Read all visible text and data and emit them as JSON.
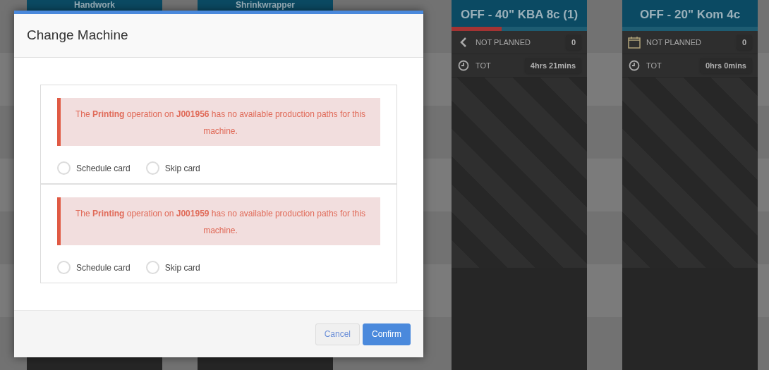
{
  "board": {
    "columns": [
      {
        "title": "Handwork"
      },
      {
        "title": "Shrinkwrapper"
      },
      {
        "title": "OFF - 40\" KBA 8c (1)",
        "progress": {
          "level": 0.37
        },
        "rows": [
          {
            "kind": "back",
            "label": "NOT PLANNED",
            "value": "0"
          },
          {
            "kind": "clock",
            "label": "TOT",
            "value": "4hrs 21mins"
          }
        ]
      },
      {
        "title": "OFF - 20\" Kom 4c",
        "rows": [
          {
            "kind": "calendar",
            "label": "NOT PLANNED",
            "value": "0"
          },
          {
            "kind": "clock",
            "label": "TOT",
            "value": "0hrs 0mins"
          }
        ]
      }
    ]
  },
  "dialog": {
    "title": "Change Machine",
    "cards": [
      {
        "message": "The **Printing** operation on **J001956** has no available production paths for this machine.",
        "options": [
          {
            "label": "Schedule card",
            "selected": false
          },
          {
            "label": "Skip card",
            "selected": false
          }
        ]
      },
      {
        "message": "The **Printing** operation on **J001959** has no available production paths for this machine.",
        "options": [
          {
            "label": "Schedule card",
            "selected": false
          },
          {
            "label": "Skip card",
            "selected": false
          }
        ]
      }
    ],
    "buttons": [
      {
        "kind": "secondary",
        "label": "Cancel"
      },
      {
        "kind": "primary",
        "label": "Confirm"
      }
    ]
  }
}
